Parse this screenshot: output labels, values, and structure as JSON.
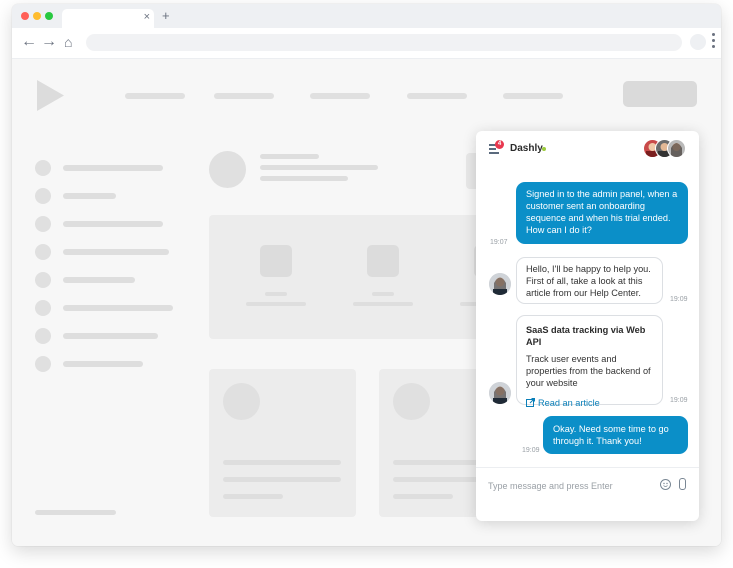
{
  "browser": {
    "tab_close_icon": "×",
    "new_tab_icon": "+",
    "back_icon": "←",
    "forward_icon": "→",
    "home_icon": "⌂"
  },
  "chat": {
    "brand": "Dashly",
    "unread_count": "4",
    "messages": {
      "m1": {
        "lines": [
          "Signed in to the admin panel, when a",
          "customer sent an onboarding",
          "sequence and when his trial ended.",
          "How can I do it?"
        ],
        "time": "19:07"
      },
      "m2": {
        "lines": [
          "Hello, I'll be happy to help you.",
          "First of all, take a look at this",
          "article from our Help Center."
        ],
        "time": "19:09"
      },
      "m3": {
        "title": "SaaS data tracking via Web API",
        "lines": [
          "Track user events and",
          "properties from the backend of",
          "your website"
        ],
        "link": "Read an article",
        "time": "19:09"
      },
      "m4": {
        "lines": [
          "Okay. Need some time to go",
          "through it. Thank you!"
        ],
        "time": "19:09"
      }
    },
    "input_placeholder": "Type message and press Enter"
  },
  "colors": {
    "accent": "#0b8fc8",
    "badge": "#e8384f",
    "online": "#9ccc3c"
  }
}
